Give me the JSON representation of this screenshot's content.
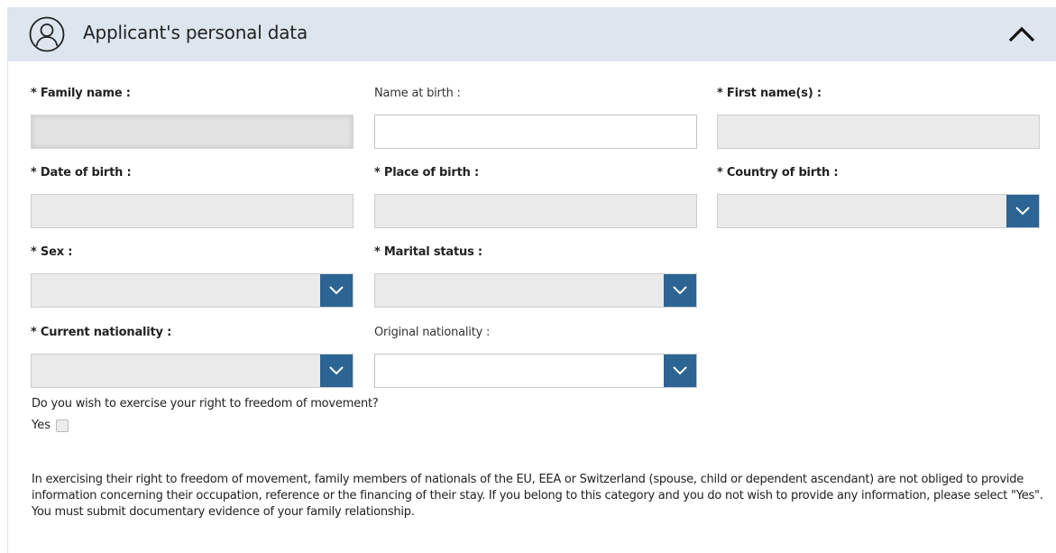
{
  "header": {
    "title": "Applicant's personal data"
  },
  "fields": {
    "family_name": {
      "label": "* Family name :",
      "value": ""
    },
    "name_at_birth": {
      "label": "Name at birth :",
      "value": ""
    },
    "first_names": {
      "label": "* First name(s) :",
      "value": ""
    },
    "date_of_birth": {
      "label": "* Date of birth :",
      "value": ""
    },
    "place_of_birth": {
      "label": "* Place of birth :",
      "value": ""
    },
    "country_of_birth": {
      "label": "* Country of birth :",
      "value": ""
    },
    "sex": {
      "label": "* Sex :",
      "value": ""
    },
    "marital_status": {
      "label": "* Marital status :",
      "value": ""
    },
    "current_nationality": {
      "label": "* Current nationality :",
      "value": ""
    },
    "original_nationality": {
      "label": "Original nationality :",
      "value": ""
    }
  },
  "freedom_of_movement": {
    "question": "Do you wish to exercise your right to freedom of movement?",
    "yes_label": "Yes",
    "checked": false,
    "info": "In exercising their right to freedom of movement, family members of nationals of the EU, EEA or Switzerland (spouse, child or dependent ascendant) are not obliged to provide information concerning their occupation, reference or the financing of their stay. If you belong to this category and you do not wish to provide any information, please select \"Yes\". You must submit documentary evidence of your family relationship."
  },
  "colors": {
    "header_bg": "#dde6ef",
    "dropdown_button": "#2c6493",
    "field_disabled": "#eaeaea"
  }
}
